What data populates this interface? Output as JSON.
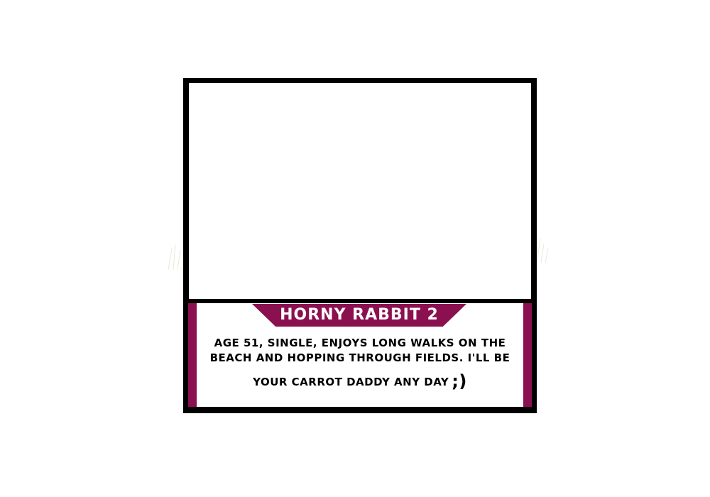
{
  "profile": {
    "name": "HORNY RABBIT 2",
    "bio_line_1": "AGE 51, SINGLE, ENJOYS LONG WALKS ON THE",
    "bio_line_2": "BEACH AND  HOPPING THROUGH FIELDS.  I'LL BE",
    "bio_line_3": "YOUR CARROT DADDY ANY DAY",
    "wink": ";)"
  },
  "colors": {
    "accent": "#8b1050",
    "frame": "#000000",
    "panel": "#ffffff"
  },
  "icons": {
    "decoration": "grass-tuft-icon"
  }
}
